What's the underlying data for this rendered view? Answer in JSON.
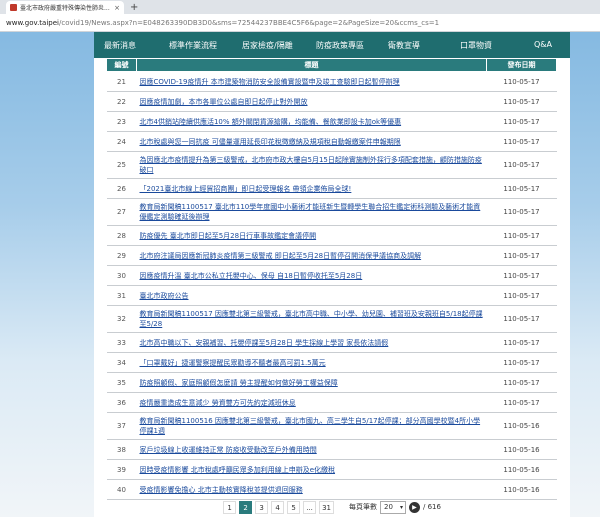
{
  "browser": {
    "tab_title": "臺北市政府嚴重特殊傳染性肺炎...",
    "tab_close": "×",
    "new_tab": "+",
    "url_host": "www.gov.taipei",
    "url_path": "/covid19/News.aspx?n=E048263390DB3D0&sms=72544237BBE4C5F6&page=2&PageSize=20&ccms_cs=1"
  },
  "nav": {
    "items": [
      "最新消息",
      "標準作業流程",
      "居家檢疫/隔離",
      "防疫政策專區",
      "衛教宣導",
      "口罩物資",
      "Q&A"
    ]
  },
  "table": {
    "headers": [
      "編號",
      "標題",
      "發布日期"
    ],
    "rows": [
      {
        "num": "21",
        "title": "因應COVID-19疫情升 本市建築物消防安全設備實設暨申及竣工查驗即日起暫停辦理",
        "date": "110-05-17",
        "lines": 1
      },
      {
        "num": "22",
        "title": "因應疫情加劇，本市各單位公處自即日起停止對外開放",
        "date": "110-05-17",
        "lines": 1
      },
      {
        "num": "23",
        "title": "北市4供銷站陸續供應活10% 額外關閉貨源搶購，均能備、餐飲業即設卡加ok等優惠",
        "date": "110-05-17",
        "lines": 1
      },
      {
        "num": "24",
        "title": "北市稅處與您一同抗疫 可儘量運用延長印花稅徵繳納及規項稅自動報繳案件申報期限",
        "date": "110-05-17",
        "lines": 1
      },
      {
        "num": "25",
        "title": "為因應北市疫情提升為第三級警戒，北市府市政大樓自5月15日起除實施制外採行多項配套措施，顧防措施防疫破口",
        "date": "110-05-17",
        "lines": 2
      },
      {
        "num": "26",
        "title": "「2021臺北市線上經貿招商團」即日起受理報名 帶領企業佈局全球!",
        "date": "110-05-17",
        "lines": 1
      },
      {
        "num": "27",
        "title": "教育局新聞稿1100517 臺北市110學年度國中小藝術才能班新生暨轉學生聯合招生鑑定術科測驗及藝術才能資優鑑定測驗確延後辦理",
        "date": "110-05-17",
        "lines": 2
      },
      {
        "num": "28",
        "title": "防疫優先 臺北市即日起至5月28日行車事故鑑定會議停開",
        "date": "110-05-17",
        "lines": 1
      },
      {
        "num": "29",
        "title": "北市府注議局因應新冠肺炎疫情第三級警戒 即日起至5月28日暫停召開消保爭議協商及調解",
        "date": "110-05-17",
        "lines": 1
      },
      {
        "num": "30",
        "title": "因應疫情升溫 臺北市公私立托嬰中心、保母 自18日暫停收托至5月28日",
        "date": "110-05-17",
        "lines": 1
      },
      {
        "num": "31",
        "title": "臺北市政府公告",
        "date": "110-05-17",
        "lines": 1
      },
      {
        "num": "32",
        "title": "教育局新聞稿1100517 因應雙北第三級警戒，臺北市高中職、中小學、幼兒園、補習班及安親班自5/18起停課至5/28",
        "date": "110-05-17",
        "lines": 2
      },
      {
        "num": "33",
        "title": "北市高中職以下、安親補習、托嬰停課至5月28日 學生採線上學習 家長依法請假",
        "date": "110-05-17",
        "lines": 1
      },
      {
        "num": "34",
        "title": "「口罩戴好」捷運警察提醒民眾勸導不聽者最高可罰1.5萬元",
        "date": "110-05-17",
        "lines": 1
      },
      {
        "num": "35",
        "title": "防疫照顧假、家庭照顧假怎麼請 勞主提醒如何做好勞工權益保障",
        "date": "110-05-17",
        "lines": 1
      },
      {
        "num": "36",
        "title": "疫情嚴重造成生意減少 勞資雙方可先約定減班休息",
        "date": "110-05-17",
        "lines": 1
      },
      {
        "num": "37",
        "title": "教育局新聞稿1100516 因應雙北第三級警戒，臺北市國九、高三學生自5/17起停課；部分高國學校暨4所小學停課1週",
        "date": "110-05-16",
        "lines": 2
      },
      {
        "num": "38",
        "title": "家戶垃圾線上收運維持正常 防疫收受動改至戶外備用時間",
        "date": "110-05-16",
        "lines": 1
      },
      {
        "num": "39",
        "title": "因時受疫情影響 北市稅處呼籲民眾多加利用線上申辦及e化繳稅",
        "date": "110-05-16",
        "lines": 1
      },
      {
        "num": "40",
        "title": "受疫情影響免擔心 北市主動核實降稅並提供退回服務",
        "date": "110-05-16",
        "lines": 1
      }
    ]
  },
  "pager": {
    "pages": [
      "1",
      "2",
      "3",
      "4",
      "5",
      "...",
      "31"
    ],
    "active_index": 1,
    "page_size_label": "每頁筆數",
    "page_size_value": "20",
    "go_icon": "▶",
    "total": "/ 616",
    "caret": "▾"
  }
}
